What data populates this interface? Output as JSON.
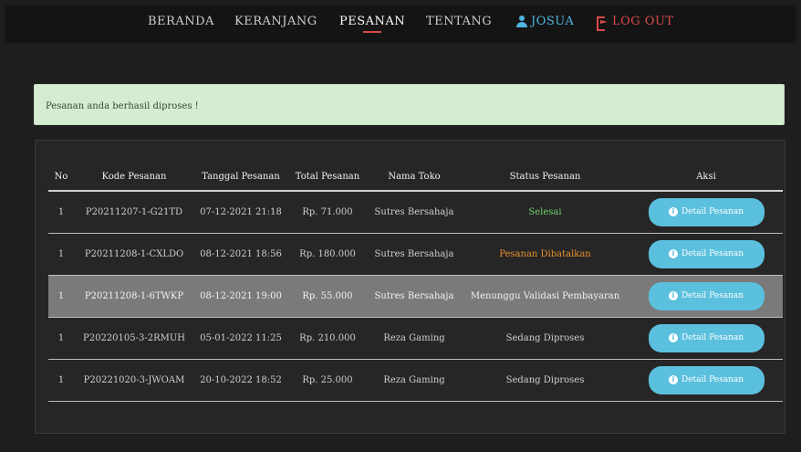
{
  "nav": {
    "beranda": "BERANDA",
    "keranjang": "KERANJANG",
    "pesanan": "PESANAN",
    "tentang": "TENTANG",
    "user": "JOSUA",
    "logout": "LOG OUT",
    "user_icon": "user-icon",
    "logout_icon": "logout-icon"
  },
  "alert": {
    "message": "Pesanan anda berhasil diproses !"
  },
  "table": {
    "headers": {
      "no": "No",
      "kode": "Kode Pesanan",
      "tanggal": "Tanggal Pesanan",
      "total": "Total Pesanan",
      "toko": "Nama Toko",
      "status": "Status Pesanan",
      "aksi": "Aksi"
    },
    "rows": [
      {
        "no": "1",
        "kode": "P20211207-1-G21TD",
        "tanggal": "07-12-2021 21:18",
        "total": "Rp. 71.000",
        "toko": "Sutres Bersahaja",
        "status": "Selesai",
        "aksi": "Detail Pesanan"
      },
      {
        "no": "1",
        "kode": "P20211208-1-CXLDO",
        "tanggal": "08-12-2021 18:56",
        "total": "Rp. 180.000",
        "toko": "Sutres Bersahaja",
        "status": "Pesanan Dibatalkan",
        "aksi": "Detail Pesanan"
      },
      {
        "no": "1",
        "kode": "P20211208-1-6TWKP",
        "tanggal": "08-12-2021 19:00",
        "total": "Rp. 55.000",
        "toko": "Sutres Bersahaja",
        "status": "Menunggu Validasi Pembayaran",
        "aksi": "Detail Pesanan"
      },
      {
        "no": "1",
        "kode": "P20220105-3-2RMUH",
        "tanggal": "05-01-2022 11:25",
        "total": "Rp. 210.000",
        "toko": "Reza Gaming",
        "status": "Sedang Diproses",
        "aksi": "Detail Pesanan"
      },
      {
        "no": "1",
        "kode": "P20221020-3-JWOAM",
        "tanggal": "20-10-2022 18:52",
        "total": "Rp. 25.000",
        "toko": "Reza Gaming",
        "status": "Sedang Diproses",
        "aksi": "Detail Pesanan"
      }
    ]
  },
  "colors": {
    "accent_blue": "#5bc0de",
    "logout_red": "#d94a4a",
    "status_done": "#6dd06d",
    "status_cancel": "#e8912c"
  }
}
